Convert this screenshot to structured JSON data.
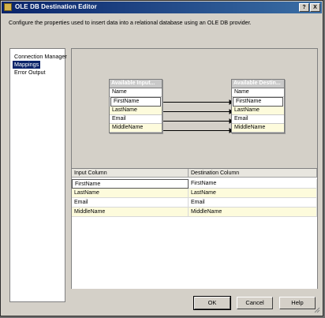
{
  "window": {
    "title": "OLE DB Destination Editor",
    "controls": [
      "?",
      "X"
    ]
  },
  "description": "Configure the properties used to insert data into a relational database using an OLE DB provider.",
  "nav": {
    "items": [
      {
        "label": "Connection Manager",
        "selected": false
      },
      {
        "label": "Mappings",
        "selected": true
      },
      {
        "label": "Error Output",
        "selected": false
      }
    ]
  },
  "diagram": {
    "input_table": {
      "header": "Available Input...",
      "columns": [
        "Name",
        "FirstName",
        "LastName",
        "Email",
        "MiddleName"
      ]
    },
    "dest_table": {
      "header": "Available Destin...",
      "columns": [
        "Name",
        "FirstName",
        "LastName",
        "Email",
        "MiddleName"
      ]
    }
  },
  "grid": {
    "headers": [
      "Input Column",
      "Destination Column"
    ],
    "rows": [
      [
        "FirstName",
        "FirstName"
      ],
      [
        "LastName",
        "LastName"
      ],
      [
        "Email",
        "Email"
      ],
      [
        "MiddleName",
        "MiddleName"
      ]
    ]
  },
  "buttons": {
    "ok": "OK",
    "cancel": "Cancel",
    "help": "Help"
  }
}
